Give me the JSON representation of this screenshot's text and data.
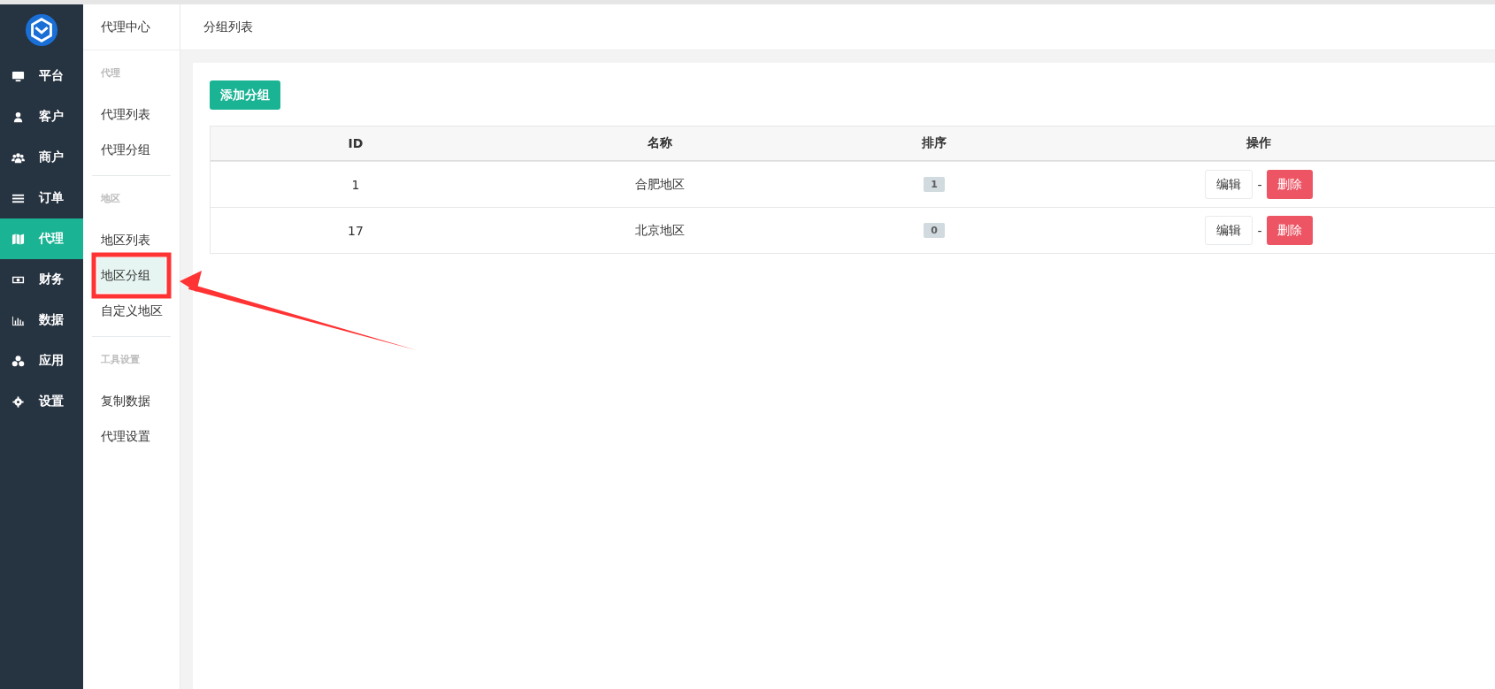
{
  "nav": {
    "items": [
      {
        "label": "平台",
        "selected": false
      },
      {
        "label": "客户",
        "selected": false
      },
      {
        "label": "商户",
        "selected": false
      },
      {
        "label": "订单",
        "selected": false
      },
      {
        "label": "代理",
        "selected": true
      },
      {
        "label": "财务",
        "selected": false
      },
      {
        "label": "数据",
        "selected": false
      },
      {
        "label": "应用",
        "selected": false
      },
      {
        "label": "设置",
        "selected": false
      }
    ]
  },
  "sidebar": {
    "title": "代理中心",
    "sections": [
      {
        "heading": "代理",
        "items": [
          {
            "label": "代理列表",
            "selected": false
          },
          {
            "label": "代理分组",
            "selected": false
          }
        ]
      },
      {
        "heading": "地区",
        "items": [
          {
            "label": "地区列表",
            "selected": false
          },
          {
            "label": "地区分组",
            "selected": true
          },
          {
            "label": "自定义地区",
            "selected": false
          }
        ]
      },
      {
        "heading": "工具设置",
        "items": [
          {
            "label": "复制数据",
            "selected": false
          },
          {
            "label": "代理设置",
            "selected": false
          }
        ]
      }
    ]
  },
  "page_title": "分组列表",
  "add_button": "添加分组",
  "table": {
    "columns": [
      "ID",
      "名称",
      "排序",
      "操作"
    ],
    "rows": [
      {
        "id": "1",
        "name": "合肥地区",
        "order": "1",
        "edit": "编辑",
        "sep": "-",
        "delete": "删除"
      },
      {
        "id": "17",
        "name": "北京地区",
        "order": "0",
        "edit": "编辑",
        "sep": "-",
        "delete": "删除"
      }
    ]
  }
}
